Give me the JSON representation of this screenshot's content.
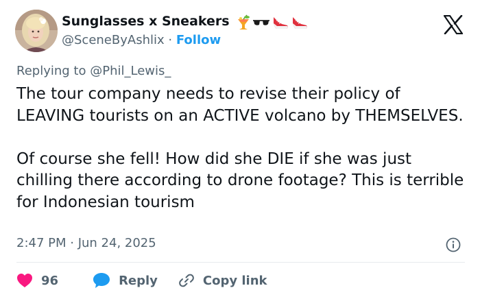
{
  "author": {
    "display_name": "Sunglasses x Sneakers",
    "handle": "@SceneByAshlix",
    "separator": "·",
    "follow_label": "Follow",
    "name_emojis": [
      "tropical-drink-icon",
      "sunglasses-icon",
      "sneaker-icon",
      "sneaker-icon"
    ]
  },
  "reply": {
    "prefix": "Replying to",
    "target": "@Phil_Lewis_"
  },
  "tweet": {
    "text": "The tour company needs to revise their policy of LEAVING tourists on an ACTIVE volcano by THEMSELVES.\n\nOf course she fell! How did she DIE if she was just chilling there according to drone footage? This is terrible for Indonesian tourism",
    "timestamp": "2:47 PM · Jun 24, 2025"
  },
  "actions": {
    "like_count": "96",
    "reply_label": "Reply",
    "copy_link_label": "Copy link"
  },
  "colors": {
    "accent": "#1d9bf0",
    "like": "#f91880",
    "secondary_text": "#536471",
    "divider": "#e7eaed"
  }
}
